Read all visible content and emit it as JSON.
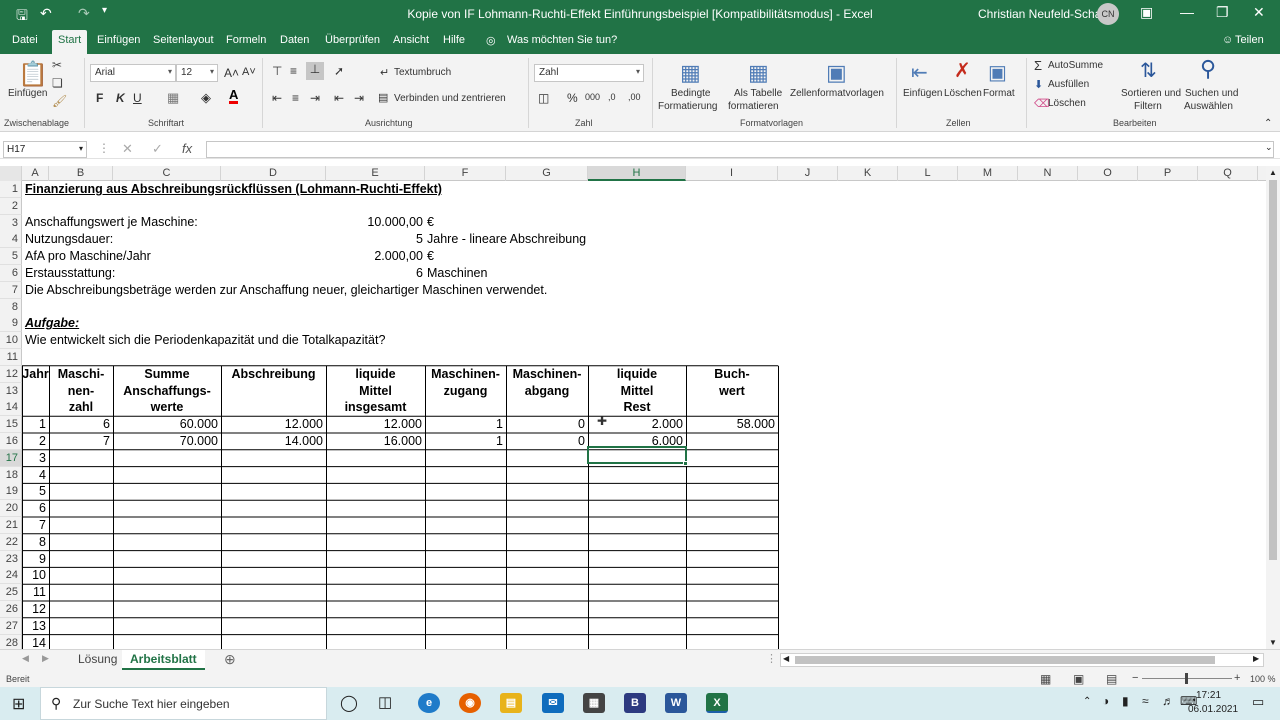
{
  "window": {
    "title": "Kopie von IF Lohmann-Ruchti-Effekt Einführungsbeispiel  [Kompatibilitätsmodus]  -  Excel",
    "user": "Christian Neufeld-Schach",
    "avatar": "CN"
  },
  "menu": {
    "items": [
      "Datei",
      "Start",
      "Einfügen",
      "Seitenlayout",
      "Formeln",
      "Daten",
      "Überprüfen",
      "Ansicht",
      "Hilfe"
    ],
    "active": "Start",
    "tell_me": "Was möchten Sie tun?",
    "share": "Teilen"
  },
  "ribbon": {
    "clipboard": {
      "paste": "Einfügen",
      "group": "Zwischenablage"
    },
    "font": {
      "name": "Arial",
      "size": "12",
      "group": "Schriftart"
    },
    "alignment": {
      "wrap": "Textumbruch",
      "merge": "Verbinden und zentrieren",
      "group": "Ausrichtung"
    },
    "number": {
      "format": "Zahl",
      "group": "Zahl"
    },
    "styles": {
      "conditional": "Bedingte",
      "conditional2": "Formatierung",
      "as_table": "Als Tabelle",
      "as_table2": "formatieren",
      "cell_styles": "Zellenformatvorlagen",
      "group": "Formatvorlagen"
    },
    "cells": {
      "insert": "Einfügen",
      "delete": "Löschen",
      "format": "Format",
      "group": "Zellen"
    },
    "editing": {
      "autosum": "AutoSumme",
      "fill": "Ausfüllen",
      "clear": "Löschen",
      "sort": "Sortieren und",
      "sort2": "Filtern",
      "find": "Suchen und",
      "find2": "Auswählen",
      "group": "Bearbeiten"
    }
  },
  "formula_bar": {
    "name_box": "H17",
    "formula": ""
  },
  "columns": [
    "A",
    "B",
    "C",
    "D",
    "E",
    "F",
    "G",
    "H",
    "I",
    "J",
    "K",
    "L",
    "M",
    "N",
    "O",
    "P",
    "Q"
  ],
  "selected_column": "H",
  "rows": [
    "1",
    "2",
    "3",
    "4",
    "5",
    "6",
    "7",
    "8",
    "9",
    "10",
    "11",
    "12",
    "13",
    "14",
    "15",
    "16",
    "17",
    "18",
    "19",
    "20",
    "21",
    "22",
    "23",
    "24",
    "25",
    "26",
    "27",
    "28"
  ],
  "selected_row": "17",
  "sheet": {
    "title": "Finanzierung aus Abschreibungsrückflüssen (Lohmann-Ruchti-Effekt)",
    "params": [
      {
        "label": "Anschaffungswert je Maschine:",
        "value": "10.000,00",
        "unit": "€"
      },
      {
        "label": "Nutzungsdauer:",
        "value": "5",
        "unit": "Jahre - lineare Abschreibung"
      },
      {
        "label": "AfA pro Maschine/Jahr",
        "value": "2.000,00",
        "unit": "€"
      },
      {
        "label": "Erstausstattung:",
        "value": "6",
        "unit": "Maschinen"
      }
    ],
    "note": "Die Abschreibungsbeträge werden zur Anschaffung neuer, gleichartiger Maschinen verwendet.",
    "task_label": "Aufgabe:",
    "task": "Wie entwickelt sich die Periodenkapazität und die Totalkapazität?",
    "headers": [
      [
        "Jahr"
      ],
      [
        "Maschi-",
        "nen-",
        "zahl"
      ],
      [
        "Summe",
        "Anschaffungs-",
        "werte"
      ],
      [
        "Abschreibung"
      ],
      [
        "liquide",
        "Mittel",
        "insgesamt"
      ],
      [
        "Maschinen-",
        "zugang"
      ],
      [
        "Maschinen-",
        "abgang"
      ],
      [
        "liquide",
        "Mittel",
        "Rest"
      ],
      [
        "Buch-",
        "wert"
      ]
    ],
    "table": [
      [
        "1",
        "6",
        "60.000",
        "12.000",
        "12.000",
        "1",
        "0",
        "2.000",
        "58.000"
      ],
      [
        "2",
        "7",
        "70.000",
        "14.000",
        "16.000",
        "1",
        "0",
        "6.000",
        ""
      ],
      [
        "3",
        "",
        "",
        "",
        "",
        "",
        "",
        "",
        ""
      ],
      [
        "4",
        "",
        "",
        "",
        "",
        "",
        "",
        "",
        ""
      ],
      [
        "5",
        "",
        "",
        "",
        "",
        "",
        "",
        "",
        ""
      ],
      [
        "6",
        "",
        "",
        "",
        "",
        "",
        "",
        "",
        ""
      ],
      [
        "7",
        "",
        "",
        "",
        "",
        "",
        "",
        "",
        ""
      ],
      [
        "8",
        "",
        "",
        "",
        "",
        "",
        "",
        "",
        ""
      ],
      [
        "9",
        "",
        "",
        "",
        "",
        "",
        "",
        "",
        ""
      ],
      [
        "10",
        "",
        "",
        "",
        "",
        "",
        "",
        "",
        ""
      ],
      [
        "11",
        "",
        "",
        "",
        "",
        "",
        "",
        "",
        ""
      ],
      [
        "12",
        "",
        "",
        "",
        "",
        "",
        "",
        "",
        ""
      ],
      [
        "13",
        "",
        "",
        "",
        "",
        "",
        "",
        "",
        ""
      ],
      [
        "14",
        "",
        "",
        "",
        "",
        "",
        "",
        "",
        ""
      ]
    ]
  },
  "tabs": {
    "items": [
      "Lösung",
      "Arbeitsblatt"
    ],
    "active": "Arbeitsblatt"
  },
  "status": {
    "ready": "Bereit",
    "zoom": "100 %"
  },
  "taskbar": {
    "search": "Zur Suche Text hier eingeben",
    "time": "17:21",
    "date": "06.01.2021"
  }
}
